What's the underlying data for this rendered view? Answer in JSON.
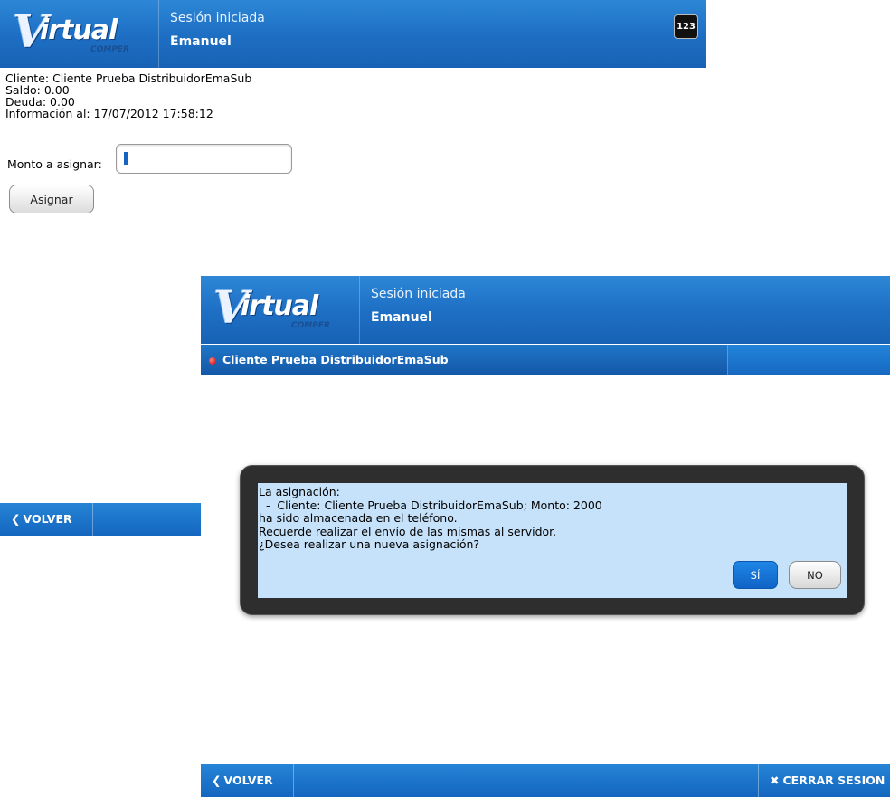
{
  "back_screen": {
    "header": {
      "logo_initial": "V",
      "logo_text": "irtual",
      "logo_sub": "COMPER",
      "session_label": "Sesión iniciada",
      "session_user": "Emanuel",
      "keyboard_label": "123"
    },
    "info": {
      "client": "Cliente: Cliente Prueba DistribuidorEmaSub",
      "balance": "Saldo: 0.00",
      "debt": "Deuda: 0.00",
      "as_of": "Información al: 17/07/2012 17:58:12"
    },
    "form": {
      "amount_label": "Monto a asignar:",
      "amount_value": "",
      "assign_button": "Asignar"
    },
    "footer": {
      "back_icon": "chevron-left-icon",
      "back_label": "VOLVER"
    }
  },
  "front_screen": {
    "header": {
      "logo_initial": "V",
      "logo_text": "irtual",
      "logo_sub": "COMPER",
      "session_label": "Sesión iniciada",
      "session_user": "Emanuel"
    },
    "client_bar": {
      "status_icon": "red-dot-icon",
      "client_name": "Cliente Prueba DistribuidorEmaSub"
    },
    "dialog": {
      "lines": [
        "La asignación:",
        "  -  Cliente: Cliente Prueba DistribuidorEmaSub; Monto: 2000",
        "ha sido almacenada en el teléfono.",
        "Recuerde realizar el envío de las mismas al servidor.",
        "¿Desea realizar una nueva asignación?"
      ],
      "yes_label": "SÍ",
      "no_label": "NO"
    },
    "footer": {
      "back_icon": "chevron-left-icon",
      "back_label": "VOLVER",
      "logout_icon": "close-icon",
      "logout_label": "CERRAR SESION"
    }
  },
  "colors": {
    "header_blue": "#1e70c5",
    "dialog_bg": "#c6e2fa",
    "dialog_frame": "#2e2e2e",
    "yes_button": "#1f86e6",
    "status_dot": "#c00000"
  }
}
